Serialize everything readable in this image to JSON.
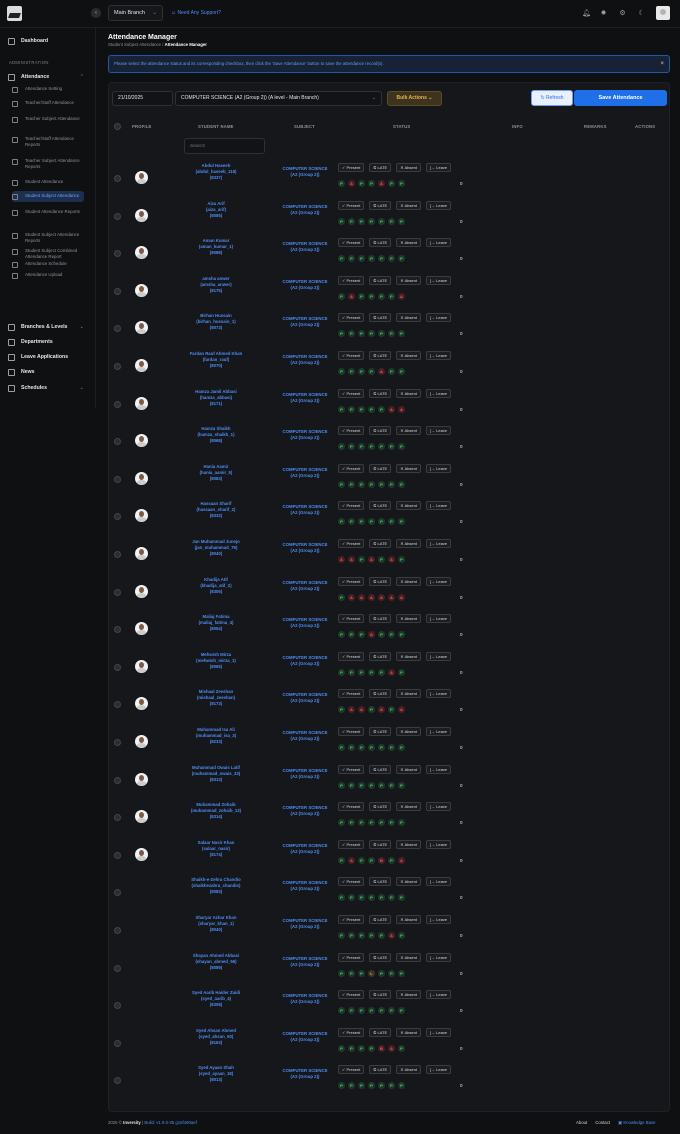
{
  "header": {
    "branch": "Main Branch",
    "support": "Need Any Support?"
  },
  "sidebar": {
    "section": "ADMINISTRATION",
    "dashboard": "Dashboard",
    "attendance": "Attendance",
    "subitems": [
      "Attendance Setting",
      "Teacher/Staff Attendance",
      "Teacher Subject Attendance",
      "Teacher/Staff Attendance Reports",
      "Teacher Subject Attendance Reports",
      "Student Attendance",
      "Student Subject Attendance",
      "Student Attendance Reports",
      "Student Subject Attendance Reports",
      "Student Subject Combined Attendance Report",
      "Attendance Schedule",
      "Attendance Upload"
    ],
    "branches": "Branches & Levels",
    "departments": "Departments",
    "leave": "Leave Applications",
    "news": "News",
    "schedules": "Schedules"
  },
  "page": {
    "title": "Attendance Manager",
    "crumb_parent": "Student Subject Attendance",
    "crumb_current": "Attendance Manager",
    "alert": "Please select the attendance status and its corresponding checkbox, then click the 'Save Attendance' button to save the attendance record(s)."
  },
  "controls": {
    "date": "21/10/2025",
    "class": "COMPUTER SCIENCE (A2 (Group 2)) (A level - Main Branch)",
    "bulk": "Bulk Actions",
    "refresh": "Refresh",
    "save": "Save Attendance",
    "search_placeholder": "Search"
  },
  "columns": [
    "PROFILE",
    "STUDENT NAME",
    "SUBJECT",
    "STATUS",
    "INFO",
    "REMARKS",
    "ACTIONS"
  ],
  "buttons": {
    "present": "✓ Present",
    "late": "LATE",
    "absent": "✕ Absent",
    "leave": "[→ Leave"
  },
  "subject": {
    "line1": "COMPUTER SCIENCE",
    "line2": "(A2 (Group 2))"
  },
  "students": [
    {
      "name": "Abdul Haseeb",
      "user": "(abdul_haseeb_118)",
      "id": "(8337)",
      "hist": "PAPPAPP",
      "count": "0",
      "pic": true
    },
    {
      "name": "Aiza Arif",
      "user": "(aiza_arif)",
      "id": "(8085)",
      "hist": "PPPPPPP",
      "count": "0",
      "pic": true
    },
    {
      "name": "Aman Kumar",
      "user": "(aman_kumar_1)",
      "id": "(8088)",
      "hist": "PPPPPPP",
      "count": "0",
      "pic": true
    },
    {
      "name": "amsha anwer",
      "user": "(amsha_anwer)",
      "id": "(8175)",
      "hist": "PAPPPPA",
      "count": "0",
      "pic": true
    },
    {
      "name": "Birhan Hussain",
      "user": "(birhan_hussain_1)",
      "id": "(8073)",
      "hist": "PPPPPPP",
      "count": "0",
      "pic": true
    },
    {
      "name": "Fardan Rauf Ahmed Khan",
      "user": "(fardan_rauf)",
      "id": "(8070)",
      "hist": "PPPPAPP",
      "count": "0",
      "pic": true
    },
    {
      "name": "Hamza Jamil Abbasi",
      "user": "(hamza_abbasi)",
      "id": "(8171)",
      "hist": "PPPPPAA",
      "count": "0",
      "pic": true
    },
    {
      "name": "Hamza Shaikh",
      "user": "(hamza_shaikh_1)",
      "id": "(8068)",
      "hist": "PPPPPPP",
      "count": "0",
      "pic": true
    },
    {
      "name": "Hania Aamir",
      "user": "(hania_aamir_5)",
      "id": "(8083)",
      "hist": "PPPPPPP",
      "count": "0",
      "pic": true
    },
    {
      "name": "Hassaan Sharif",
      "user": "(hassaan_sharif_2)",
      "id": "(8332)",
      "hist": "PPPPPPP",
      "count": "0",
      "pic": true
    },
    {
      "name": "Jan Muhammad Junejo",
      "user": "(jan_muhammad_79)",
      "id": "(8040)",
      "hist": "AAPAPAP",
      "count": "0",
      "pic": true
    },
    {
      "name": "Khadija Atif",
      "user": "(khadija_atif_2)",
      "id": "(8305)",
      "hist": "PAAAAAA",
      "count": "0",
      "pic": true
    },
    {
      "name": "Maliaj Fatima",
      "user": "(maliaj_fatima_4)",
      "id": "(8054)",
      "hist": "PPPAPPP",
      "count": "0",
      "pic": true
    },
    {
      "name": "Mehwish Mirza",
      "user": "(mehwish_mirza_1)",
      "id": "(8065)",
      "hist": "PPPPPAP",
      "count": "0",
      "pic": true
    },
    {
      "name": "Mishaal Zeeshan",
      "user": "(mishaal_zeeshan)",
      "id": "(8173)",
      "hist": "PAAPAPA",
      "count": "0",
      "pic": true
    },
    {
      "name": "Muhammad Isa Ali",
      "user": "(muhammad_isa_3)",
      "id": "(8233)",
      "hist": "PPPPPPP",
      "count": "0",
      "pic": true
    },
    {
      "name": "Muhammad Owais Latif",
      "user": "(muhammad_owais_33)",
      "id": "(8313)",
      "hist": "PPPPPPP",
      "count": "0",
      "pic": true
    },
    {
      "name": "Muhammad Zohaib",
      "user": "(muhammad_zohaib_13)",
      "id": "(8314)",
      "hist": "PPPPPPP",
      "count": "0",
      "pic": true
    },
    {
      "name": "Salaar Nasir Khan",
      "user": "(salaar_nasir)",
      "id": "(8174)",
      "hist": "PAPPBPA",
      "count": "0",
      "pic": true
    },
    {
      "name": "Shaikh-e-Zehra Chandio",
      "user": "(shaikhezahra_chandio)",
      "id": "(8083)",
      "hist": "PPPPPPP",
      "count": "0",
      "pic": false
    },
    {
      "name": "Sharyar Azhar Khan",
      "user": "(sharyar_khan_1)",
      "id": "(8040)",
      "hist": "PPPPPAP",
      "count": "0",
      "pic": false
    },
    {
      "name": "Shayan Ahmed Abbasi",
      "user": "(shayan_ahmed_56)",
      "id": "(8089)",
      "hist": "PPPLPPP",
      "count": "0",
      "pic": false
    },
    {
      "name": "Syed Aarib Haider Zaidi",
      "user": "(syed_aarib_4)",
      "id": "(8308)",
      "hist": "PPPPPPP",
      "count": "0",
      "pic": false
    },
    {
      "name": "Syed Ahsan Ahmed",
      "user": "(syed_ahsan_60)",
      "id": "(8163)",
      "hist": "PPPPBAP",
      "count": "0",
      "pic": false
    },
    {
      "name": "Syed Ayaan Shah",
      "user": "(syed_ayaan_18)",
      "id": "(8013)",
      "hist": "PPPPPPP",
      "count": "0",
      "pic": false
    }
  ],
  "footer": {
    "year": "2025 ©",
    "brand": "Inversity",
    "build": "Build: v1.9.0-35 g16f490aef",
    "about": "About",
    "contact": "Contact",
    "kb": "Knowledge Base"
  }
}
